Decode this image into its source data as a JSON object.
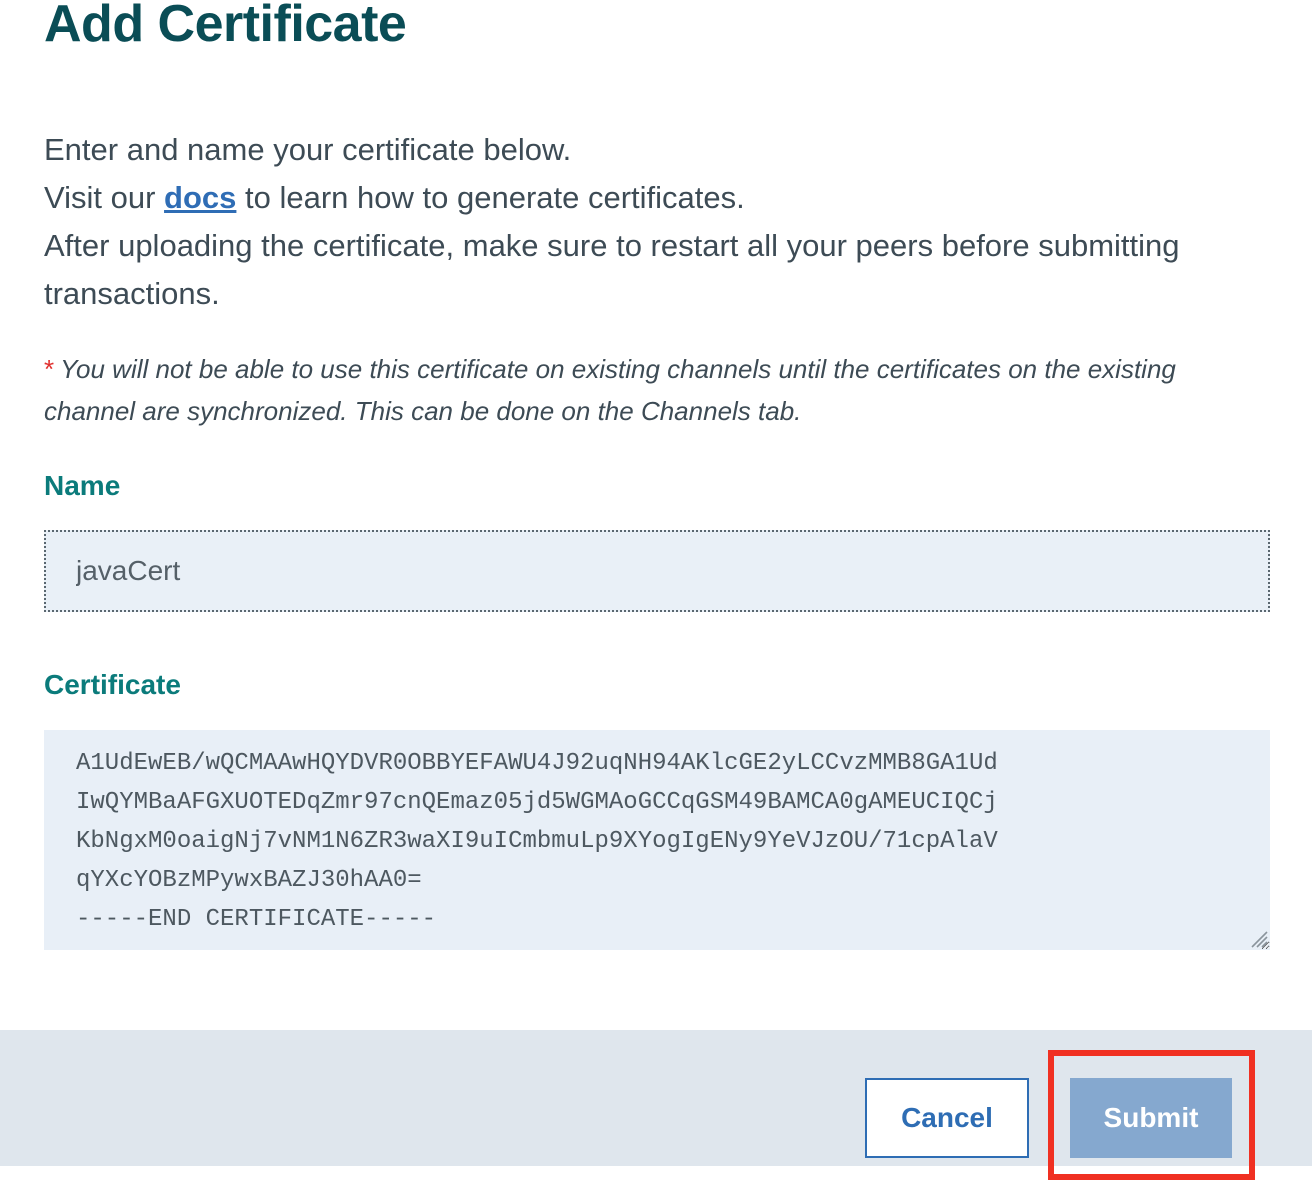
{
  "dialog": {
    "title": "Add Certificate",
    "intro": {
      "line1": "Enter and name your certificate below.",
      "line2_prefix": "Visit our ",
      "docs_link": "docs",
      "line2_suffix": " to learn how to generate certificates.",
      "line3": "After uploading the certificate, make sure to restart all your peers before submitting transactions."
    },
    "warning": {
      "asterisk": "*",
      "text": "You will not be able to use this certificate on existing channels until the certificates on the existing channel are synchronized. This can be done on the Channels tab."
    },
    "name_field": {
      "label": "Name",
      "value": "javaCert"
    },
    "certificate_field": {
      "label": "Certificate",
      "value": "A1UdEwEB/wQCMAAwHQYDVR0OBBYEFAWU4J92uqNH94AKlcGE2yLCCvzMMB8GA1Ud\nIwQYMBaAFGXUOTEDqZmr97cnQEmaz05jd5WGMAoGCCqGSM49BAMCA0gAMEUCIQCj\nKbNgxM0oaigNj7vNM1N6ZR3waXI9uICmbmuLp9XYogIgENy9YeVJzOU/71cpAlaV\nqYXcYOBzMPywxBAZJ30hAA0=\n-----END CERTIFICATE-----"
    }
  },
  "footer": {
    "cancel_label": "Cancel",
    "submit_label": "Submit"
  },
  "colors": {
    "title": "#0a4d56",
    "label": "#0b7b7b",
    "link": "#2f6db5",
    "input_bg": "#e9f0f7",
    "footer_bg": "#dfe6ed",
    "submit_bg": "#85a8cf",
    "highlight": "#f03022"
  }
}
